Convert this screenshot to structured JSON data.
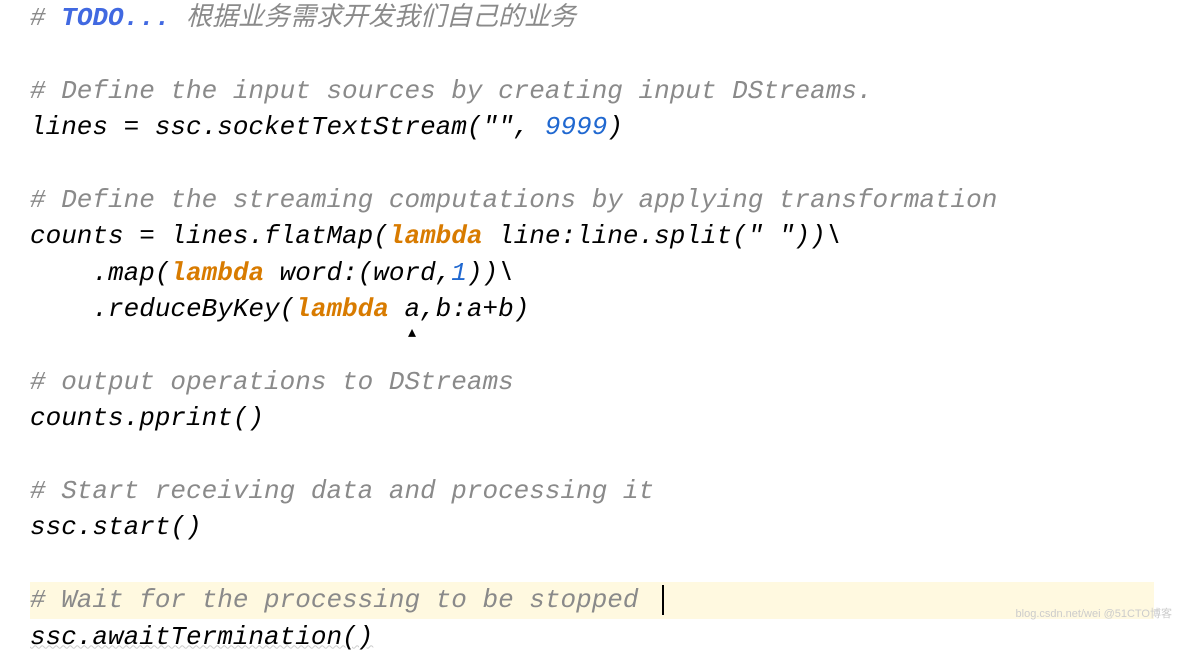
{
  "code": {
    "line0_hash": "#",
    "line0_todo": " TODO...",
    "line0_cn": " 根据业务需求开发我们自己的业务",
    "line1_comment": "# Define the input sources by creating input DStreams.",
    "line2_a": "lines = ssc.socketTextStream(",
    "line2_str": "\"\"",
    "line2_b": ", ",
    "line2_num": "9999",
    "line2_c": ")",
    "line3_comment": "# Define the streaming computations by applying transformation",
    "line4_a": "counts = lines.flatMap(",
    "line4_kw": "lambda",
    "line4_b": " line:line.split(",
    "line4_str": "\" \"",
    "line4_c": "))\\",
    "line5_a": "    .map(",
    "line5_kw": "lambda",
    "line5_b": " word:(word,",
    "line5_num": "1",
    "line5_c": "))\\",
    "line6_a": "    .reduceByKey(",
    "line6_kw": "lambda",
    "line6_b": " a,b:a+b)",
    "line7_comment": "# output operations to DStreams",
    "line8": "counts.pprint()",
    "line9_comment": "# Start receiving data and processing it",
    "line10": "ssc.start()",
    "line11_comment": "# Wait for the processing to be stopped ",
    "line12": "ssc.awaitTermination()"
  },
  "watermark": "blog.csdn.net/wei @51CTO博客"
}
